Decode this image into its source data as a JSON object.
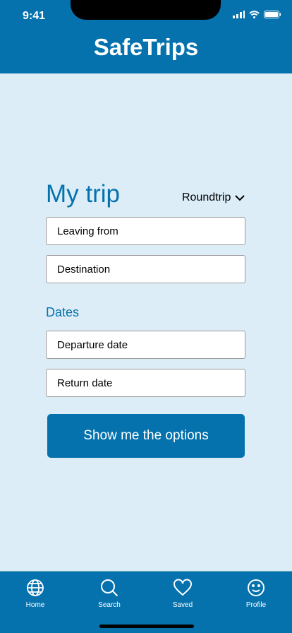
{
  "status": {
    "time": "9:41"
  },
  "header": {
    "title": "SafeTrips"
  },
  "trip": {
    "heading": "My trip",
    "trip_type": "Roundtrip",
    "leaving_placeholder": "Leaving from",
    "destination_placeholder": "Destination",
    "dates_label": "Dates",
    "departure_placeholder": "Departure date",
    "return_placeholder": "Return date",
    "submit": "Show me the options"
  },
  "tabs": [
    {
      "label": "Home",
      "icon": "globe-icon"
    },
    {
      "label": "Search",
      "icon": "search-icon"
    },
    {
      "label": "Saved",
      "icon": "heart-icon"
    },
    {
      "label": "Profile",
      "icon": "smiley-icon"
    }
  ]
}
